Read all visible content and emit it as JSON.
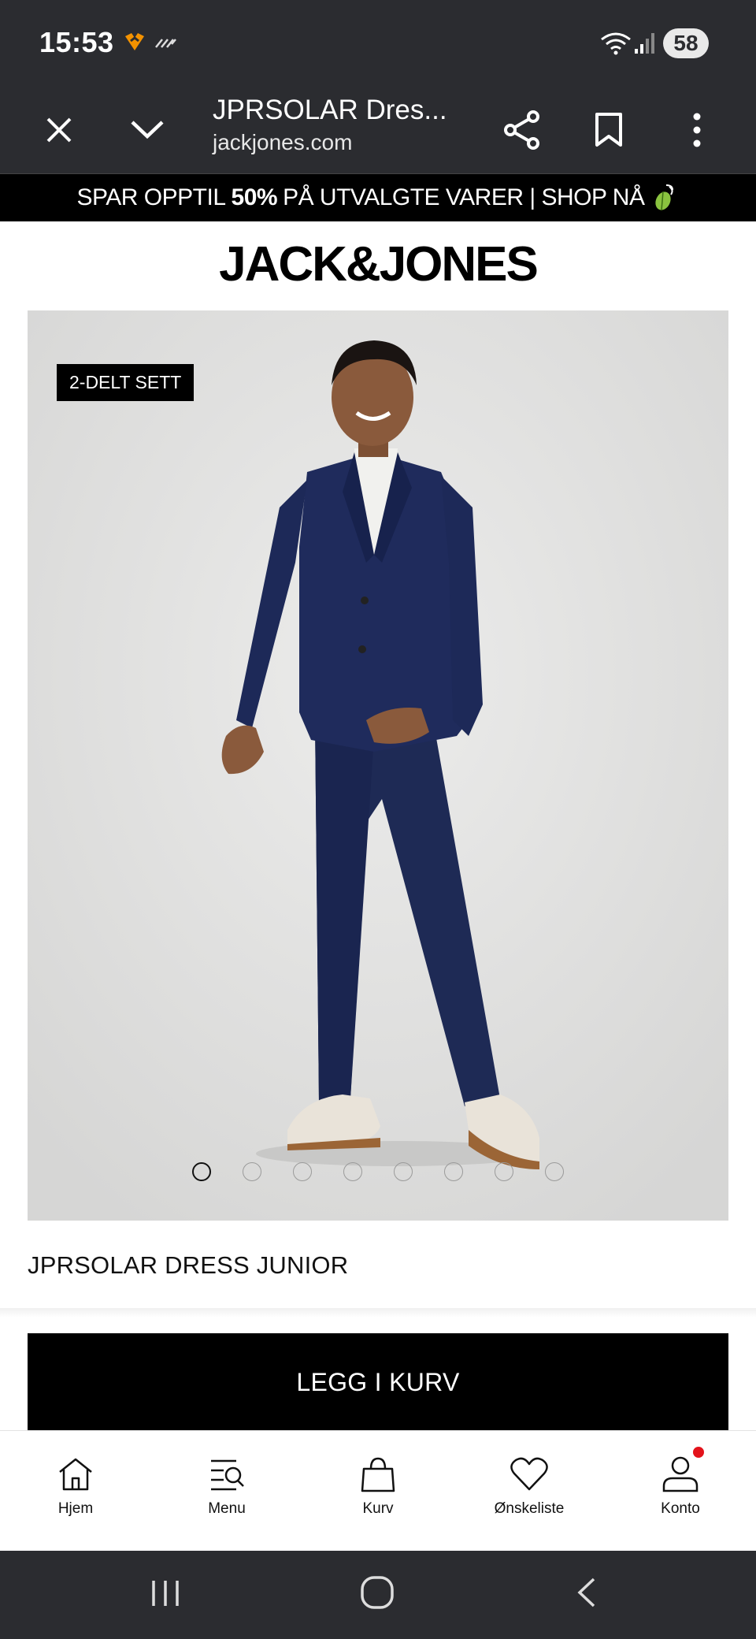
{
  "status_bar": {
    "time": "15:53",
    "battery": "58"
  },
  "browser": {
    "title": "JPRSOLAR Dres...",
    "url": "jackjones.com"
  },
  "promo": {
    "text_before": "SPAR OPPTIL",
    "highlight": "50%",
    "text_after": "PÅ UTVALGTE VARER | SHOP NÅ"
  },
  "logo": "JACK&JONES",
  "product": {
    "badge": "2-DELT SETT",
    "name": "JPRSOLAR DRESS JUNIOR",
    "image_count": 8,
    "active_image": 1
  },
  "cart_button": "LEGG I KURV",
  "bottom_nav": {
    "home": "Hjem",
    "menu": "Menu",
    "cart": "Kurv",
    "wishlist": "Ønskeliste",
    "account": "Konto"
  },
  "colors": {
    "system_bar": "#2b2c30",
    "accent": "#000000",
    "notification_dot": "#e3131b"
  }
}
